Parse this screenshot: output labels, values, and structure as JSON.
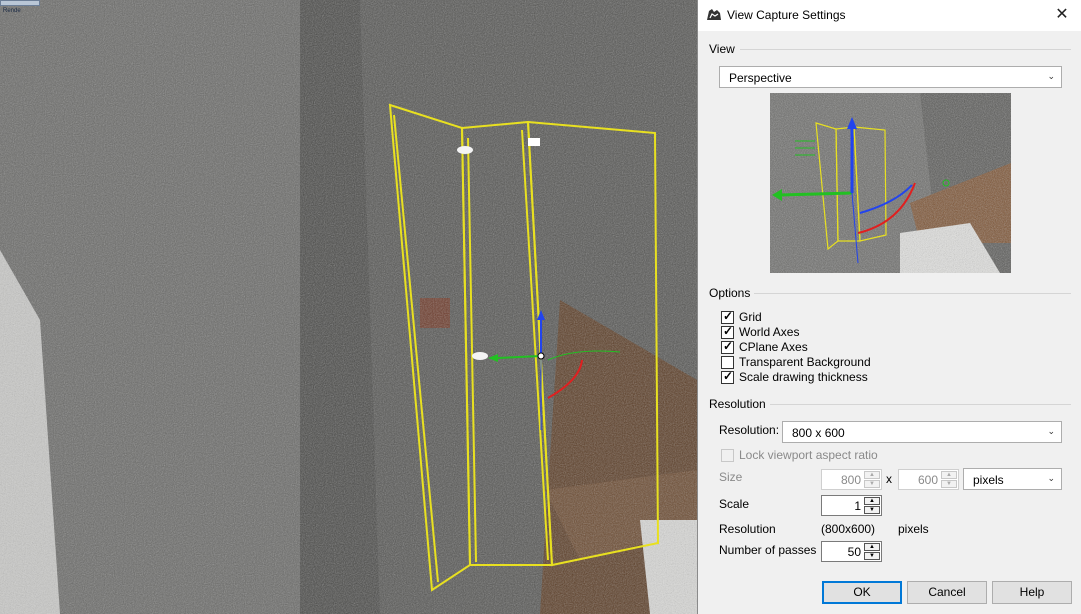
{
  "viewport": {
    "label": "Rende"
  },
  "dialog": {
    "title": "View Capture Settings",
    "close_glyph": "✕",
    "view_section": "View",
    "view_select": "Perspective",
    "options_section": "Options",
    "options": [
      {
        "label": "Grid",
        "checked": true
      },
      {
        "label": "World Axes",
        "checked": true
      },
      {
        "label": "CPlane Axes",
        "checked": true
      },
      {
        "label": "Transparent Background",
        "checked": false
      },
      {
        "label": "Scale drawing thickness",
        "checked": true
      }
    ],
    "resolution_section": "Resolution",
    "resolution_label": "Resolution:",
    "resolution_select": "800 x 600",
    "lock_aspect_label": "Lock viewport aspect ratio",
    "size_label": "Size",
    "width_value": "800",
    "times": "x",
    "height_value": "600",
    "unit_select": "pixels",
    "scale_label": "Scale",
    "scale_value": "1",
    "res_info_label": "Resolution",
    "res_info_value": "(800x600)",
    "res_info_unit": "pixels",
    "passes_label": "Number of passes",
    "passes_value": "50",
    "ok_label": "OK",
    "cancel_label": "Cancel",
    "help_label": "Help"
  },
  "colors": {
    "selection_outline": "#e8e020",
    "axis_x": "#22c022",
    "axis_y": "#2244ee",
    "axis_z": "#e02020",
    "accent": "#0078d7"
  },
  "icons": [
    "rhino-app-icon",
    "close-icon",
    "chevron-down-icon",
    "checkmark-icon",
    "spin-up-icon",
    "spin-down-icon"
  ]
}
